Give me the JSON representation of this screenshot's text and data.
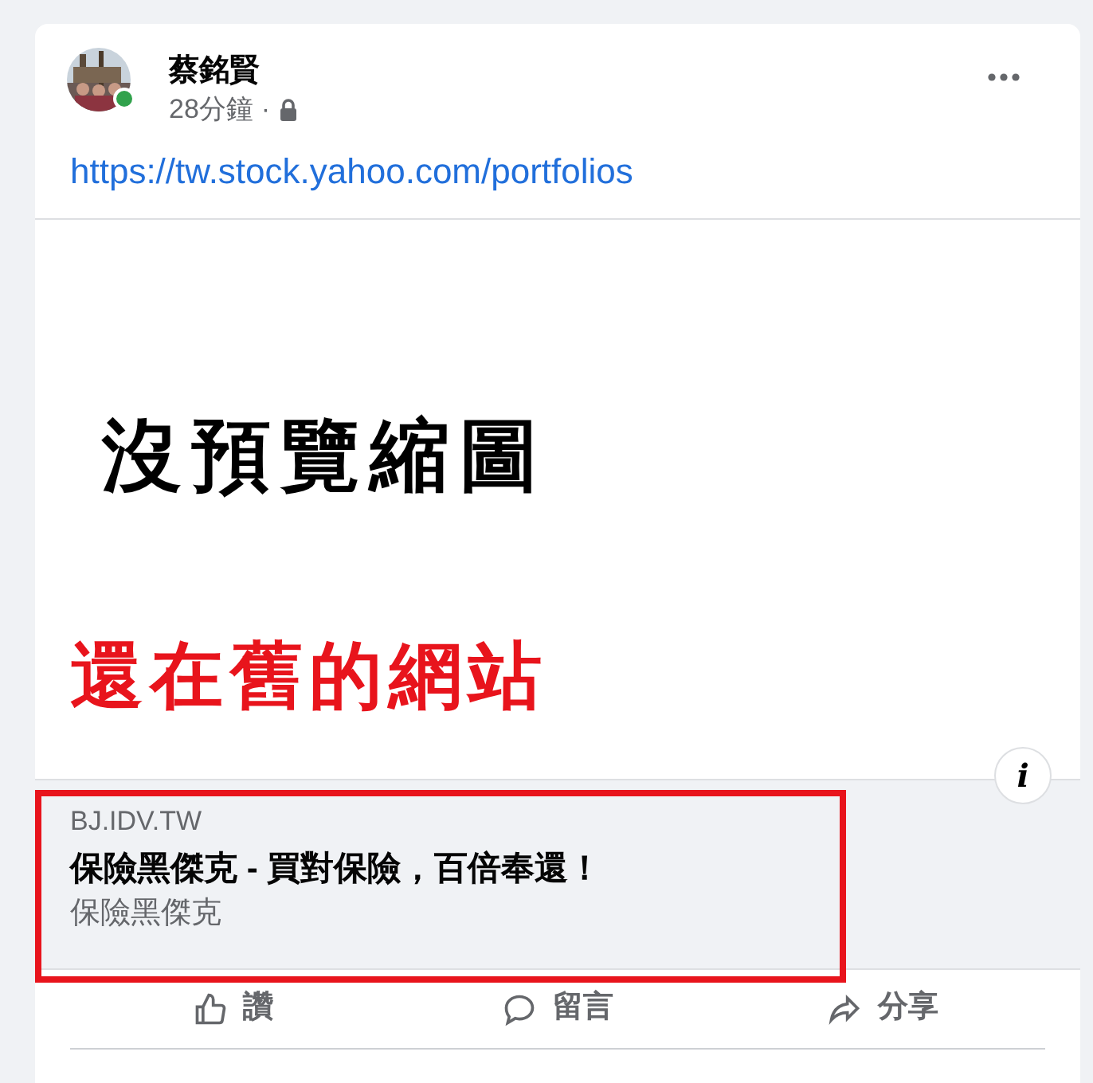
{
  "post": {
    "author": "蔡銘賢",
    "time": "28分鐘",
    "separator": "·",
    "online": true,
    "link_text": "https://tw.stock.yahoo.com/portfolios"
  },
  "preview": {
    "overlay_text": "沒預覽縮圖",
    "annotation": "還在舊的網站",
    "info": "i"
  },
  "link_card": {
    "domain": "BJ.IDV.TW",
    "title": "保險黑傑克 - 買對保險，百倍奉還！",
    "description": "保險黑傑克",
    "highlighted": true
  },
  "actions": [
    {
      "kind": "like",
      "label": "讚"
    },
    {
      "kind": "comment",
      "label": "留言"
    },
    {
      "kind": "share",
      "label": "分享"
    }
  ]
}
